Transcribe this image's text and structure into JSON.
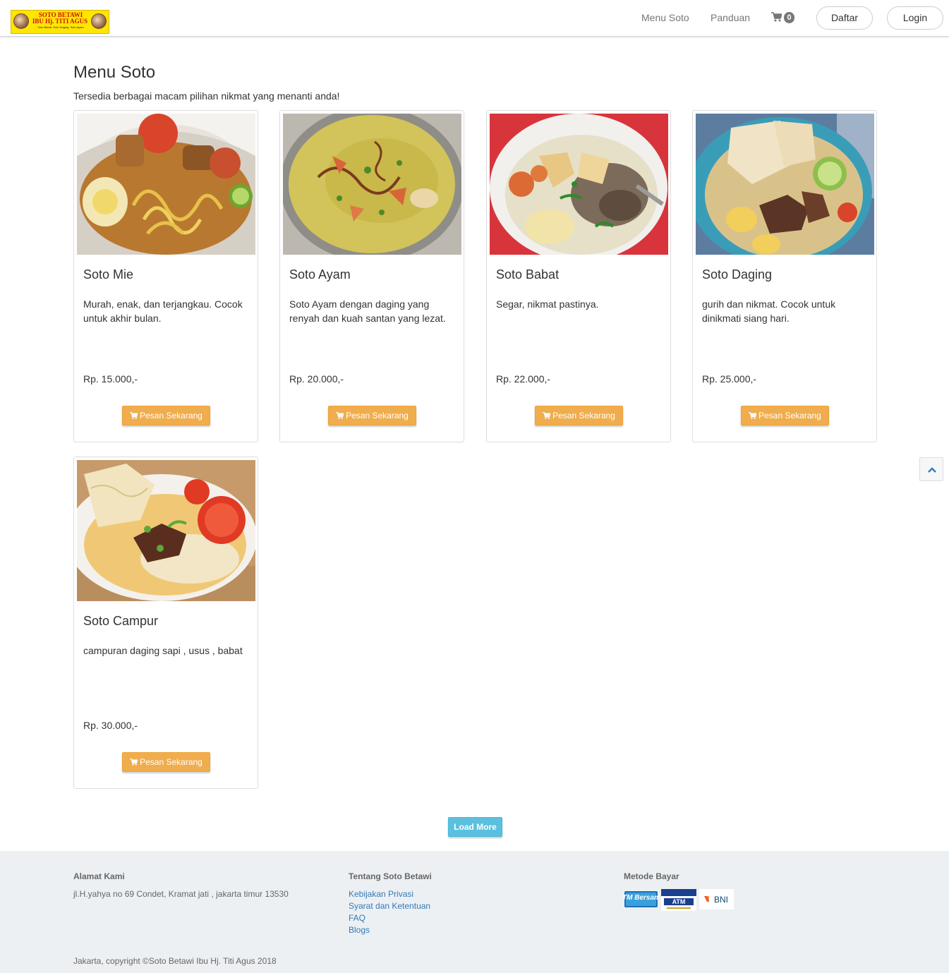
{
  "logo": {
    "line1": "SOTO BETAWI",
    "line2": "IBU Hj. TITI AGUS",
    "line3": "Soto Babat, Soto Daging, Soto Ayam"
  },
  "nav": {
    "menu_label": "Menu Soto",
    "guide_label": "Panduan",
    "cart_count": "0",
    "register_label": "Daftar",
    "login_label": "Login"
  },
  "header": {
    "title": "Menu Soto",
    "subtitle": "Tersedia berbagai macam pilihan nikmat yang menanti anda!"
  },
  "products": [
    {
      "name": "Soto Mie",
      "description": "Murah, enak, dan terjangkau. Cocok untuk akhir bulan.",
      "price": "Rp. 15.000,-",
      "button": "Pesan Sekarang"
    },
    {
      "name": "Soto Ayam",
      "description": "Soto Ayam dengan daging yang renyah dan kuah santan yang lezat.",
      "price": "Rp. 20.000,-",
      "button": "Pesan Sekarang"
    },
    {
      "name": "Soto Babat",
      "description": "Segar, nikmat pastinya.",
      "price": "Rp. 22.000,-",
      "button": "Pesan Sekarang"
    },
    {
      "name": "Soto Daging",
      "description": "gurih dan nikmat. Cocok untuk dinikmati siang hari.",
      "price": "Rp. 25.000,-",
      "button": "Pesan Sekarang"
    },
    {
      "name": "Soto Campur",
      "description": "campuran daging sapi , usus , babat",
      "price": "Rp. 30.000,-",
      "button": "Pesan Sekarang"
    }
  ],
  "load_more_label": "Load More",
  "footer": {
    "address_title": "Alamat Kami",
    "address": "jl.H.yahya no 69 Condet, Kramat jati , jakarta timur 13530",
    "about_title": "Tentang Soto Betawi",
    "links": [
      "Kebijakan Privasi",
      "Syarat dan Ketentuan",
      "FAQ",
      "Blogs"
    ],
    "payment_title": "Metode Bayar",
    "payment_methods": [
      "ATM Bersama",
      "ATM",
      "BNI"
    ],
    "copyright": "Jakarta, copyright ©Soto Betawi Ibu Hj. Titi Agus 2018"
  },
  "colors": {
    "order_button": "#f0ad4e",
    "load_more_button": "#5bc0de",
    "link": "#337ab7",
    "footer_bg": "#edf0f3"
  }
}
